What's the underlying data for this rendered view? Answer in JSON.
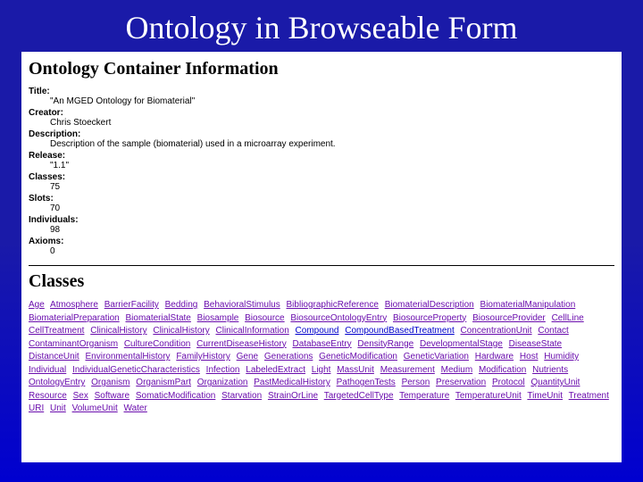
{
  "slide": {
    "title": "Ontology in Browseable Form"
  },
  "container": {
    "heading": "Ontology Container Information",
    "fields": {
      "title_label": "Title:",
      "title_value": "\"An MGED Ontology for Biomaterial\"",
      "creator_label": "Creator:",
      "creator_value": "Chris Stoeckert",
      "description_label": "Description:",
      "description_value": "Description of the sample (biomaterial) used in a microarray experiment.",
      "release_label": "Release:",
      "release_value": "\"1.1\"",
      "classes_label": "Classes:",
      "classes_value": "75",
      "slots_label": "Slots:",
      "slots_value": "70",
      "individuals_label": "Individuals:",
      "individuals_value": "98",
      "axioms_label": "Axioms:",
      "axioms_value": "0"
    }
  },
  "classes": {
    "heading": "Classes",
    "items": [
      "Age",
      "Atmosphere",
      "BarrierFacility",
      "Bedding",
      "BehavioralStimulus",
      "BibliographicReference",
      "BiomaterialDescription",
      "BiomaterialManipulation",
      "BiomaterialPreparation",
      "BiomaterialState",
      "Biosample",
      "Biosource",
      "BiosourceOntologyEntry",
      "BiosourceProperty",
      "BiosourceProvider",
      "CellLine",
      "CellTreatment",
      "ClinicalHistory",
      "ClinicalHistory",
      "ClinicalInformation",
      "Compound",
      "CompoundBasedTreatment",
      "ConcentrationUnit",
      "Contact",
      "ContaminantOrganism",
      "CultureCondition",
      "CurrentDiseaseHistory",
      "DatabaseEntry",
      "DensityRange",
      "DevelopmentalStage",
      "DiseaseState",
      "DistanceUnit",
      "EnvironmentalHistory",
      "FamilyHistory",
      "Gene",
      "Generations",
      "GeneticModification",
      "GeneticVariation",
      "Hardware",
      "Host",
      "Humidity",
      "Individual",
      "IndividualGeneticCharacteristics",
      "Infection",
      "LabeledExtract",
      "Light",
      "MassUnit",
      "Measurement",
      "Medium",
      "Modification",
      "Nutrients",
      "OntologyEntry",
      "Organism",
      "OrganismPart",
      "Organization",
      "PastMedicalHistory",
      "PathogenTests",
      "Person",
      "Preservation",
      "Protocol",
      "QuantityUnit",
      "Resource",
      "Sex",
      "Software",
      "SomaticModification",
      "Starvation",
      "StrainOrLine",
      "TargetedCellType",
      "Temperature",
      "TemperatureUnit",
      "TimeUnit",
      "Treatment",
      "URI",
      "Unit",
      "VolumeUnit",
      "Water"
    ],
    "blue_items": [
      "Compound",
      "CompoundBasedTreatment"
    ]
  }
}
